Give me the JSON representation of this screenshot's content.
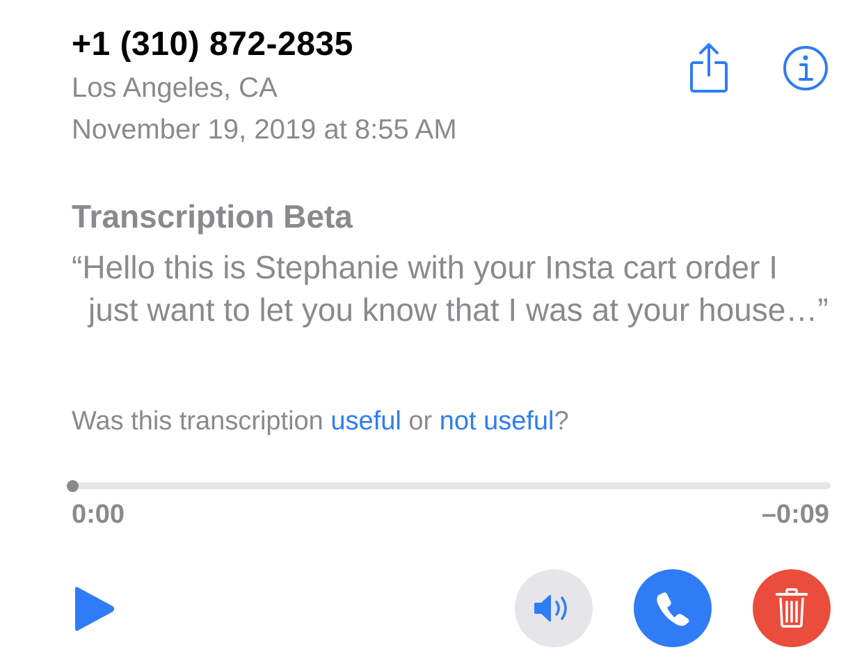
{
  "header": {
    "phone_number": "+1 (310) 872-2835",
    "location": "Los Angeles, CA",
    "datetime": "November 19, 2019 at 8:55 AM"
  },
  "toolbar": {
    "share_icon": "share-icon",
    "info_icon": "info-icon"
  },
  "transcription": {
    "title": "Transcription Beta",
    "text": "“Hello this is Stephanie with your Insta cart order I just want to let you know that I was at your house…”"
  },
  "feedback": {
    "prefix": "Was this transcription ",
    "useful_label": "useful",
    "middle": " or ",
    "not_useful_label": "not useful",
    "suffix": "?"
  },
  "player": {
    "elapsed": "0:00",
    "remaining": "–0:09",
    "progress": 0
  },
  "controls": {
    "play_icon": "play-icon",
    "speaker_icon": "speaker-icon",
    "call_icon": "phone-icon",
    "delete_icon": "trash-icon"
  },
  "colors": {
    "accent": "#2f7cf6",
    "secondary_text": "#8a8a8e",
    "delete": "#eb4d3d",
    "speaker_bg": "#e5e5ea"
  }
}
